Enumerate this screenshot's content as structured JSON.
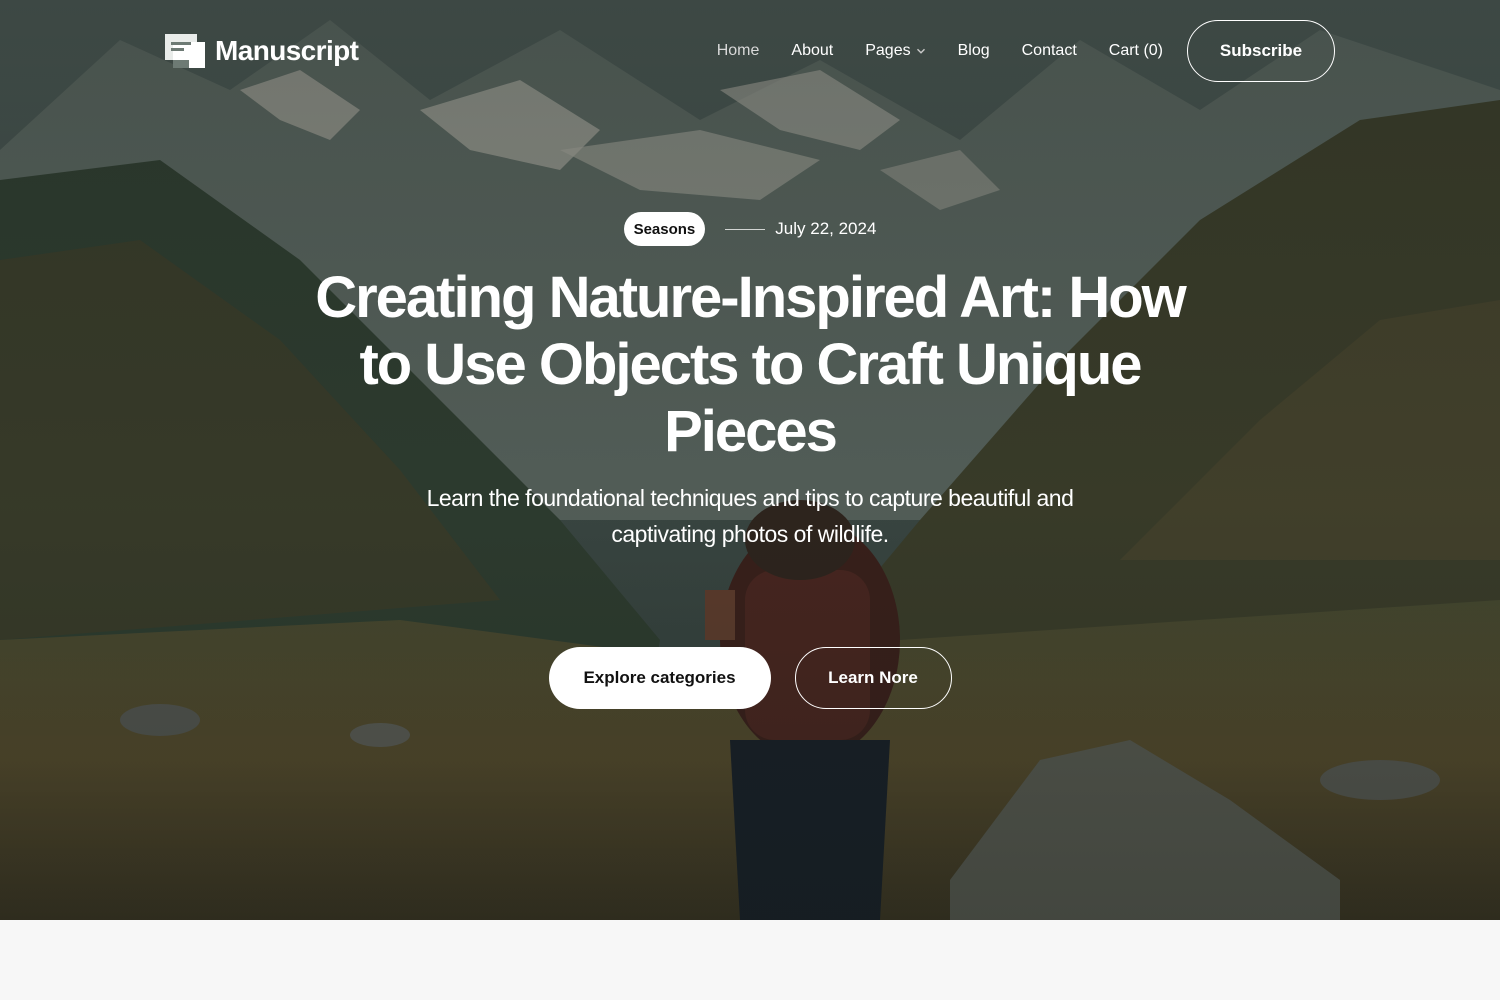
{
  "header": {
    "logo_text": "Manuscript",
    "logo_icon": "chat-document-icon",
    "nav": [
      {
        "label": "Home",
        "active": true
      },
      {
        "label": "About"
      },
      {
        "label": "Pages",
        "has_dropdown": true
      },
      {
        "label": "Blog"
      },
      {
        "label": "Contact"
      },
      {
        "label": "Cart (0)"
      }
    ],
    "subscribe_label": "Subscribe"
  },
  "hero": {
    "category": "Seasons",
    "date": "July 22, 2024",
    "title": "Creating Nature-Inspired Art: How to Use Objects to Craft Unique Pieces",
    "subtitle": "Learn the foundational techniques and tips to capture beautiful and captivating photos of wildlife.",
    "primary_cta": "Explore categories",
    "secondary_cta": "Learn Nore"
  },
  "colors": {
    "overlay": "#1b2520",
    "button_fill": "#ffffff",
    "text_on_dark": "#ffffff",
    "page_background": "#f7f7f7"
  }
}
